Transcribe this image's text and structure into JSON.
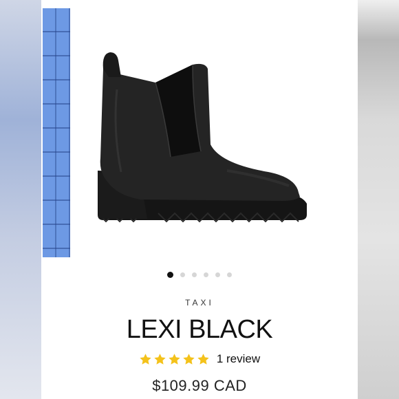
{
  "product": {
    "brand": "TAXI",
    "name": "LEXI BLACK",
    "review_count_text": "1 review",
    "rating": 5,
    "rating_max": 5,
    "price": "$109.99 CAD"
  },
  "carousel": {
    "image_count": 6,
    "active_index": 0
  },
  "colors": {
    "star": "#f4c21b",
    "active_dot": "#111111",
    "inactive_dot": "#d6d6d6"
  },
  "icons": {
    "star": "star-icon"
  }
}
